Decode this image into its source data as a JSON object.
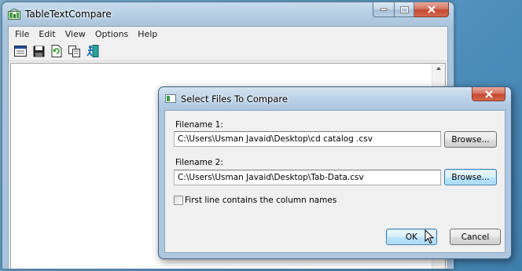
{
  "main_window": {
    "title": "TableTextCompare",
    "menu": [
      "File",
      "Edit",
      "View",
      "Options",
      "Help"
    ],
    "toolbar_icons": [
      "window-icon",
      "save-icon",
      "refresh-icon",
      "copy-icon",
      "exit-icon"
    ]
  },
  "dialog": {
    "title": "Select Files To Compare",
    "filename1_label": "Filename 1:",
    "filename1_value": "C:\\Users\\Usman Javaid\\Desktop\\cd catalog .csv",
    "browse1_label": "Browse...",
    "filename2_label": "Filename 2:",
    "filename2_value": "C:\\Users\\Usman Javaid\\Desktop\\Tab-Data.csv",
    "browse2_label": "Browse...",
    "checkbox_label": "First line contains the column names",
    "checkbox_checked": false,
    "ok_label": "OK",
    "cancel_label": "Cancel"
  },
  "colors": {
    "titlebar": "#b5cde2",
    "close_button": "#c4482f",
    "focused_button": "#3c7fb1"
  }
}
